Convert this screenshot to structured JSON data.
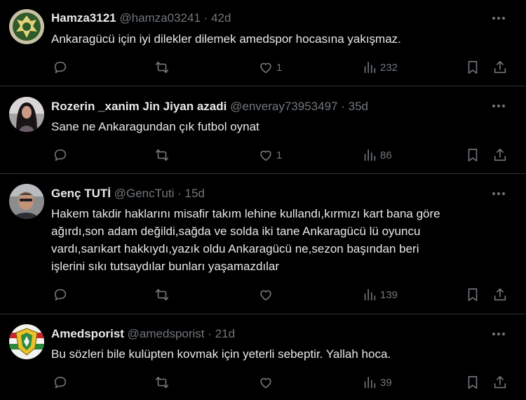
{
  "tweets": [
    {
      "name": "Hamza3121",
      "handle": "@hamza03241",
      "sep": "·",
      "age": "42d",
      "lines": [
        "Ankaragücü için iyi dilekler dilemek amedspor hocasına yakışmaz."
      ],
      "likes": "1",
      "views": "232",
      "avatar": "emblem"
    },
    {
      "name": "Rozerin _xanim Jin Jiyan azadi",
      "handle": "@enveray73953497",
      "sep": "·",
      "age": "35d",
      "lines": [
        "Sane ne Ankaragundan çık futbol oynat"
      ],
      "likes": "1",
      "views": "86",
      "avatar": "photo-woman"
    },
    {
      "name": "Genç TUTİ",
      "handle": "@GencTuti",
      "sep": "·",
      "age": "15d",
      "lines": [
        "Hakem takdir haklarını misafir takım lehine kullandı,kırmızı kart bana göre",
        "ağırdı,son adam değildi,sağda ve solda iki tane Ankaragücü lü oyuncu",
        "vardı,sarıkart hakkıydı,yazık oldu Ankaragücü ne,sezon başından beri",
        "işlerini sıkı tutsaydılar bunları yaşamazdılar"
      ],
      "likes": "",
      "views": "139",
      "avatar": "photo-man"
    },
    {
      "name": "Amedsporist",
      "handle": "@amedsporist",
      "sep": "·",
      "age": "21d",
      "lines": [
        "Bu sözleri bile kulüpten kovmak için yeterli sebeptir. Yallah hoca."
      ],
      "likes": "",
      "views": "39",
      "avatar": "amedspor-logo"
    }
  ],
  "icons": [
    "reply-icon",
    "retweet-icon",
    "like-icon",
    "views-icon",
    "bookmark-icon",
    "share-icon",
    "more-icon"
  ],
  "colors": {
    "background": "#000000",
    "text": "#e7e9ea",
    "muted": "#71767b",
    "divider": "#2f3336"
  }
}
